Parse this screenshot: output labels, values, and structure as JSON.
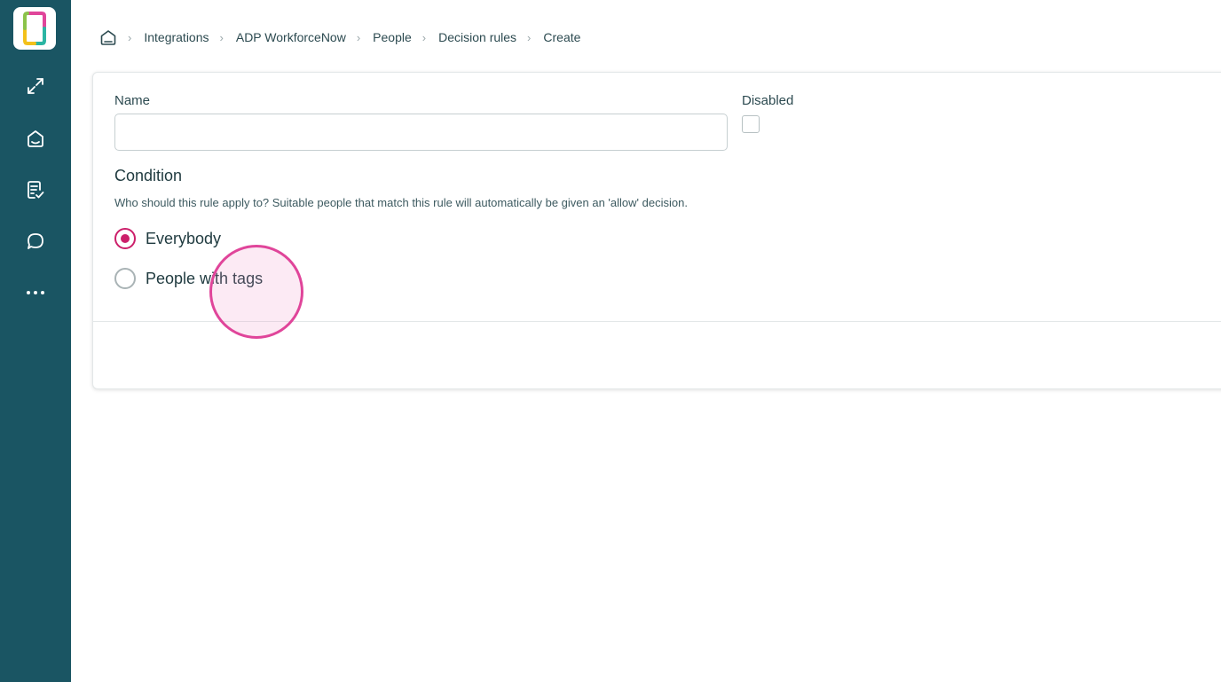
{
  "sidebar": {
    "items": [
      {
        "name": "expand-icon"
      },
      {
        "name": "home-icon"
      },
      {
        "name": "checklist-icon"
      },
      {
        "name": "chat-icon"
      },
      {
        "name": "more-icon"
      }
    ]
  },
  "breadcrumb": {
    "items": [
      "Integrations",
      "ADP WorkforceNow",
      "People",
      "Decision rules",
      "Create"
    ]
  },
  "form": {
    "name_label": "Name",
    "name_value": "",
    "disabled_label": "Disabled",
    "condition_title": "Condition",
    "condition_help": "Who should this rule apply to? Suitable people that match this rule will automatically be given an 'allow' decision.",
    "options": [
      {
        "label": "Everybody",
        "selected": true
      },
      {
        "label": "People with tags",
        "selected": false
      }
    ]
  },
  "colors": {
    "sidebar": "#1a5563",
    "accent": "#cc1f6a",
    "click_indicator": "#e0459a"
  }
}
